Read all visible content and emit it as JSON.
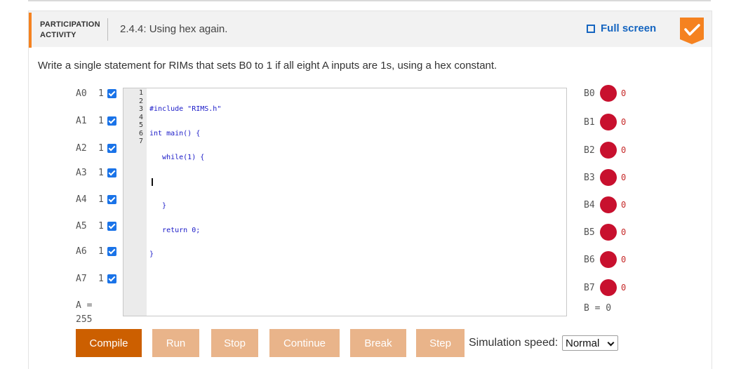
{
  "header": {
    "participation_line1": "PARTICIPATION",
    "participation_line2": "ACTIVITY",
    "title": "2.4.4: Using hex again.",
    "fullscreen_label": "Full screen"
  },
  "instructions": "Write a single statement for RIMs that sets B0 to 1 if all eight A inputs are 1s, using a hex constant.",
  "inputs": [
    {
      "name": "A0",
      "value": "1",
      "checked": true
    },
    {
      "name": "A1",
      "value": "1",
      "checked": true
    },
    {
      "name": "A2",
      "value": "1",
      "checked": true
    },
    {
      "name": "A3",
      "value": "1",
      "checked": true
    },
    {
      "name": "A4",
      "value": "1",
      "checked": true
    },
    {
      "name": "A5",
      "value": "1",
      "checked": true
    },
    {
      "name": "A6",
      "value": "1",
      "checked": true
    },
    {
      "name": "A7",
      "value": "1",
      "checked": true
    }
  ],
  "a_summary": {
    "label": "A =",
    "value": "255"
  },
  "editor": {
    "line_numbers": [
      "1",
      "2",
      "3",
      "4",
      "5",
      "6",
      "7"
    ],
    "lines": [
      "#include \"RIMS.h\"",
      "int main() {",
      "   while(1) {",
      "",
      "   }",
      "   return 0;",
      "}"
    ]
  },
  "outputs": [
    {
      "name": "B0",
      "value": "0"
    },
    {
      "name": "B1",
      "value": "0"
    },
    {
      "name": "B2",
      "value": "0"
    },
    {
      "name": "B3",
      "value": "0"
    },
    {
      "name": "B4",
      "value": "0"
    },
    {
      "name": "B5",
      "value": "0"
    },
    {
      "name": "B6",
      "value": "0"
    },
    {
      "name": "B7",
      "value": "0"
    }
  ],
  "b_summary": "B = 0",
  "buttons": {
    "compile": "Compile",
    "run": "Run",
    "stop": "Stop",
    "continue": "Continue",
    "break": "Break",
    "step": "Step"
  },
  "speed": {
    "label": "Simulation speed:",
    "selected": "Normal"
  },
  "colors": {
    "accent": "#f58220",
    "primary_button": "#cc5f00",
    "disabled_button": "#e9b48a",
    "led_off": "#c8102e",
    "link": "#1565c0",
    "checkbox": "#1a73e8"
  }
}
